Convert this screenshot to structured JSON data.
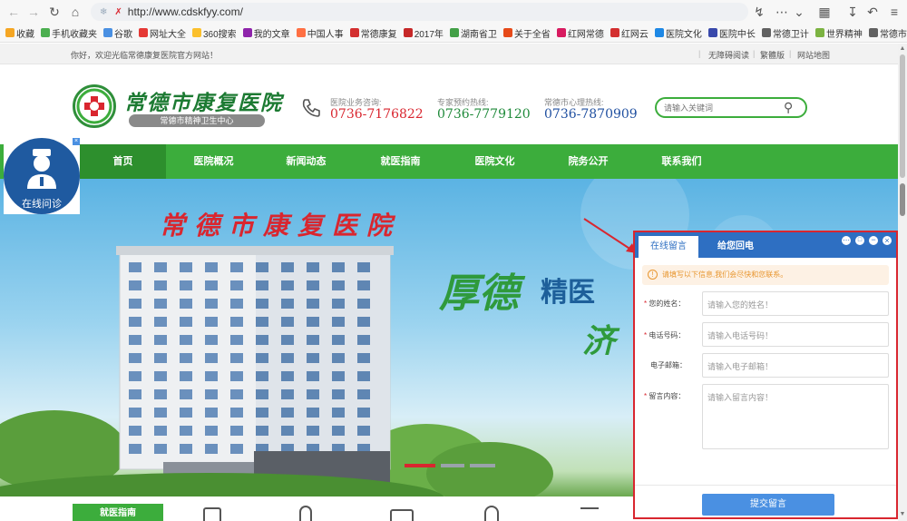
{
  "browser": {
    "url": "http://www.cdskfyy.com/",
    "bookmarks": [
      {
        "label": "收藏",
        "icon": "star-icon"
      },
      {
        "label": "手机收藏夹",
        "icon": "phone-icon"
      },
      {
        "label": "谷歌",
        "icon": "globe-icon"
      },
      {
        "label": "网址大全",
        "icon": "site-icon"
      },
      {
        "label": "360搜索",
        "icon": "search-icon"
      },
      {
        "label": "我的文章",
        "icon": "doc-icon"
      },
      {
        "label": "中国人事",
        "icon": "site-icon"
      },
      {
        "label": "常德康复",
        "icon": "site-icon"
      },
      {
        "label": "2017年",
        "icon": "site-icon"
      },
      {
        "label": "湖南省卫",
        "icon": "site-icon"
      },
      {
        "label": "关于全省",
        "icon": "site-icon"
      },
      {
        "label": "红网常德",
        "icon": "site-icon"
      },
      {
        "label": "红网云",
        "icon": "site-icon"
      },
      {
        "label": "医院文化",
        "icon": "site-icon"
      },
      {
        "label": "医院中长",
        "icon": "site-icon"
      },
      {
        "label": "常德卫计",
        "icon": "globe-icon"
      },
      {
        "label": "世界精神",
        "icon": "play-icon"
      },
      {
        "label": "常德市专",
        "icon": "globe-icon"
      }
    ]
  },
  "topbar": {
    "welcome": "你好，欢迎光临常德康复医院官方网站！",
    "links": [
      "无障碍阅读",
      "繁體版",
      "网站地图"
    ]
  },
  "header": {
    "logo_title": "常德市康复医院",
    "logo_subtitle": "常德市精神卫生中心",
    "hotlines": [
      {
        "label": "医院业务咨询:",
        "number": "0736-7176822"
      },
      {
        "label": "专家预约热线:",
        "number": "0736-7779120"
      },
      {
        "label": "常德市心理热线:",
        "number": "0736-7870909"
      }
    ],
    "search_placeholder": "请输入关键词"
  },
  "nav": [
    "首页",
    "医院概况",
    "新闻动态",
    "就医指南",
    "医院文化",
    "院务公开",
    "联系我们"
  ],
  "banner": {
    "building_sign": "常德市康复医院",
    "slogan_1": "厚德",
    "slogan_2": "精医",
    "slogan_3": "济"
  },
  "float_consult": {
    "label": "在线问诊"
  },
  "bottom": {
    "first_tab": "就医指南"
  },
  "chat": {
    "tabs": [
      "在线留言",
      "给您回电"
    ],
    "notice": "请填写以下信息,我们会尽快和您联系。",
    "fields": [
      {
        "label": "您的姓名：",
        "required": true,
        "placeholder": "请输入您的姓名！"
      },
      {
        "label": "电话号码：",
        "required": true,
        "placeholder": "请输入电话号码！"
      },
      {
        "label": "电子邮箱：",
        "required": false,
        "placeholder": "请输入电子邮箱！"
      },
      {
        "label": "留言内容：",
        "required": true,
        "placeholder": "请输入留言内容！"
      }
    ],
    "submit": "提交留言"
  },
  "colors": {
    "brand_green": "#3cad3c",
    "panel_border": "#d9262f",
    "phone_red": "#d9262f",
    "phone_green": "#1f8a3a",
    "phone_blue": "#1f4fa0",
    "submit_blue": "#4a90e2"
  }
}
